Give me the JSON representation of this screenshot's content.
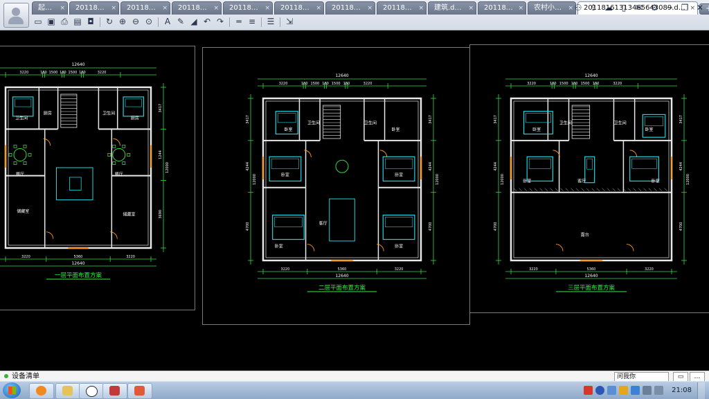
{
  "app": {
    "tabs": [
      {
        "label": "起…"
      },
      {
        "label": "20118…"
      },
      {
        "label": "20118…"
      },
      {
        "label": "20118…"
      },
      {
        "label": "20118…"
      },
      {
        "label": "20118…"
      },
      {
        "label": "20118…"
      },
      {
        "label": "20118…"
      },
      {
        "label": "建筑.d…"
      },
      {
        "label": "20118…"
      },
      {
        "label": "农村小…"
      },
      {
        "label": "20118161313465643089.d…",
        "active": true
      }
    ],
    "tab_close_glyph": "×",
    "tab_add_glyph": "+"
  },
  "toolbar_icons": [
    "open-icon",
    "save-icon",
    "print-icon",
    "print-preview-icon",
    "lock-icon",
    "separator",
    "rotate-icon",
    "zoom-in-icon",
    "zoom-out-icon",
    "zoom-window-icon",
    "separator",
    "text-icon",
    "pencil-icon",
    "eraser-icon",
    "undo-icon",
    "redo-icon",
    "separator",
    "measure-icon",
    "dimension-icon",
    "separator",
    "layers-icon",
    "separator",
    "export-icon"
  ],
  "window_controls": [
    "users-icon",
    "share-icon",
    "cloud-icon",
    "phone-icon",
    "mail-icon",
    "settings-icon",
    "minimize-icon",
    "restore-icon",
    "close-icon"
  ],
  "drawings": [
    {
      "caption": "一层平面布置方案",
      "overall_dim": "12640",
      "top_dims": [
        "3220",
        "180",
        "1500",
        "180",
        "1500",
        "180",
        "3220"
      ],
      "bottom_dims": [
        "3220",
        "5360",
        "3220"
      ],
      "side_dims": [
        "3417",
        "1244",
        "3690",
        "12000"
      ],
      "rooms": [
        "卫生间",
        "厨房",
        "卫生间",
        "厨房",
        "餐厅",
        "餐厅",
        "储藏室",
        "储藏室"
      ]
    },
    {
      "caption": "二层平面布置方案",
      "overall_dim": "12640",
      "top_dims": [
        "3220",
        "180",
        "1500",
        "180",
        "1500",
        "180",
        "3220"
      ],
      "bottom_dims": [
        "3220",
        "5360",
        "3220"
      ],
      "side_dims": [
        "3417",
        "4244",
        "4700",
        "12000"
      ],
      "rooms": [
        "卧室",
        "卫生间",
        "卫生间",
        "卧室",
        "卧室",
        "卧室",
        "客厅",
        "卧室",
        "卧室"
      ]
    },
    {
      "caption": "三层平面布置方案",
      "overall_dim": "12640",
      "top_dims": [
        "3220",
        "180",
        "1500",
        "180",
        "1500",
        "180",
        "3220"
      ],
      "bottom_dims": [
        "3220",
        "5360",
        "3220"
      ],
      "side_dims": [
        "3417",
        "4244",
        "4700",
        "12000"
      ],
      "rooms": [
        "卧室",
        "卫生间",
        "卫生间",
        "卧室",
        "卧室",
        "客厅",
        "卧室",
        "露台"
      ]
    }
  ],
  "statusbar": {
    "label": "设备清单"
  },
  "ime": {
    "label": "问我你"
  },
  "clock": {
    "time": "21:08"
  },
  "colors": {
    "wall": "#e8e8e8",
    "dim": "#33dd44",
    "furniture": "#19d6e0",
    "door": "#ff9a20",
    "hatch": "#cfcfcf",
    "caption": "#33ee44",
    "text": "#ffffff"
  }
}
